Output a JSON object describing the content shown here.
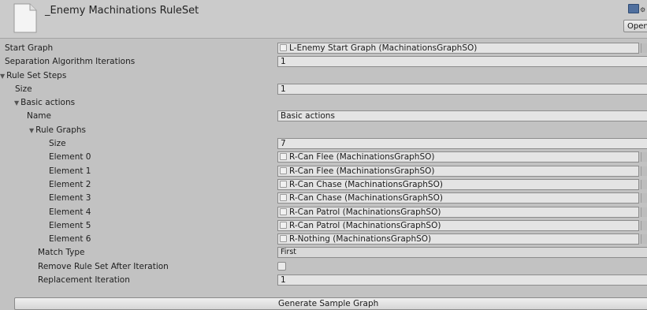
{
  "header": {
    "title": "_Enemy Machinations RuleSet",
    "open_label": "Open"
  },
  "fields": {
    "start_graph": {
      "label": "Start Graph",
      "value": "L-Enemy Start Graph (MachinationsGraphSO)"
    },
    "separation_iterations": {
      "label": "Separation Algorithm Iterations",
      "value": "1"
    },
    "rule_set_steps": {
      "label": "Rule Set Steps"
    },
    "steps_size": {
      "label": "Size",
      "value": "1"
    },
    "basic_actions": {
      "label": "Basic actions"
    },
    "name": {
      "label": "Name",
      "value": "Basic actions"
    },
    "rule_graphs": {
      "label": "Rule Graphs"
    },
    "rule_graphs_size": {
      "label": "Size",
      "value": "7"
    },
    "elements": [
      {
        "label": "Element 0",
        "value": "R-Can Flee (MachinationsGraphSO)"
      },
      {
        "label": "Element 1",
        "value": "R-Can Flee (MachinationsGraphSO)"
      },
      {
        "label": "Element 2",
        "value": "R-Can Chase (MachinationsGraphSO)"
      },
      {
        "label": "Element 3",
        "value": "R-Can Chase (MachinationsGraphSO)"
      },
      {
        "label": "Element 4",
        "value": "R-Can Patrol (MachinationsGraphSO)"
      },
      {
        "label": "Element 5",
        "value": "R-Can Patrol (MachinationsGraphSO)"
      },
      {
        "label": "Element 6",
        "value": "R-Nothing (MachinationsGraphSO)"
      }
    ],
    "match_type": {
      "label": "Match Type",
      "value": "First"
    },
    "remove_after_iteration": {
      "label": "Remove Rule Set After Iteration",
      "checked": false
    },
    "replacement_iteration": {
      "label": "Replacement Iteration",
      "value": "1"
    }
  },
  "buttons": {
    "generate": "Generate Sample Graph"
  },
  "icons": {
    "file": "file-icon",
    "foldout": "triangle-down-icon",
    "object": "object-field-icon"
  }
}
